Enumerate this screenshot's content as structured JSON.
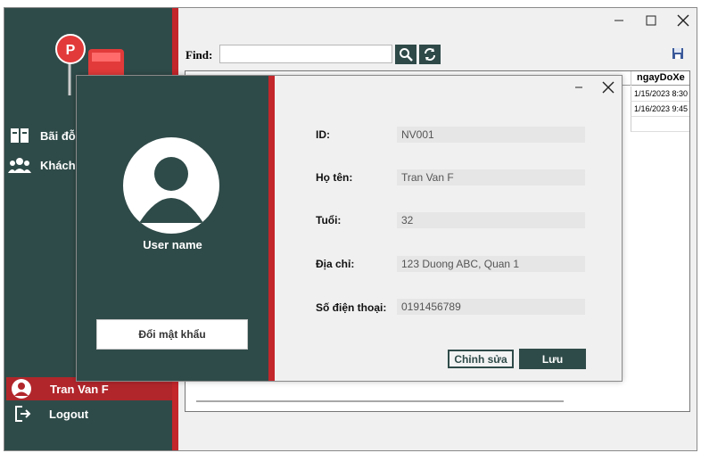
{
  "sidebar": {
    "items": [
      {
        "label": "Bãi đỗ",
        "icon": "book-icon"
      },
      {
        "label": "Khách",
        "icon": "users-icon"
      }
    ],
    "user_label": "Tran Van F",
    "logout_label": "Logout"
  },
  "toolbar": {
    "find_label": "Find:",
    "find_value": ""
  },
  "grid": {
    "last_column_header": "ngayDoXe",
    "rows": [
      "1/15/2023 8:30 ...",
      "1/16/2023 9:45 ..."
    ]
  },
  "dialog": {
    "username": "User name",
    "change_password_label": "Đổi mật khẩu",
    "fields": [
      {
        "label": "ID:",
        "value": "NV001"
      },
      {
        "label": "Họ tên:",
        "value": "Tran Van F"
      },
      {
        "label": "Tuổi:",
        "value": "32"
      },
      {
        "label": "Địa chỉ:",
        "value": "123 Duong ABC, Quan 1"
      },
      {
        "label": "Số điện thoại:",
        "value": "0191456789"
      }
    ],
    "edit_label": "Chỉnh sửa",
    "save_label": "Lưu"
  },
  "colors": {
    "primary": "#2f4b49",
    "accent": "#c3262b"
  }
}
